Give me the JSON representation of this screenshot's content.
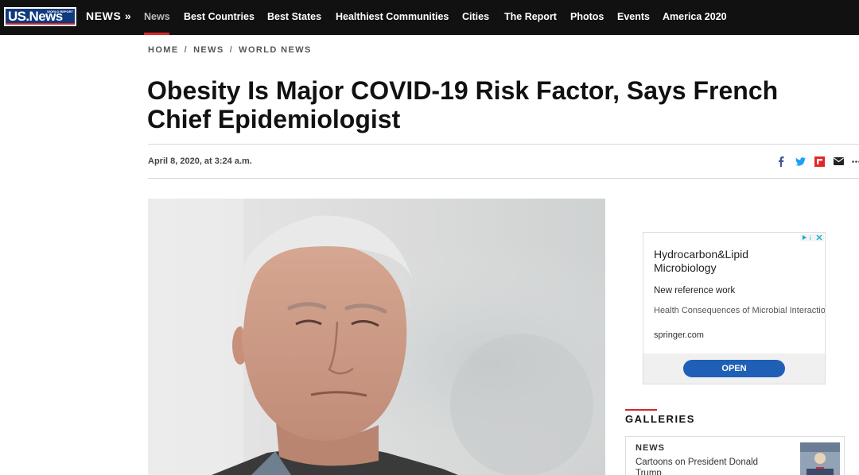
{
  "brand": {
    "logo_text": "US.News",
    "logo_small": "WORLD REPORT",
    "red": "#d6242b",
    "blue": "#0f3a7d"
  },
  "nav": {
    "home_label": "NEWS »",
    "items": [
      "News",
      "Best Countries",
      "Best States",
      "Healthiest Communities",
      "Cities",
      "The Report",
      "Photos",
      "Events",
      "America 2020"
    ]
  },
  "breadcrumb": [
    "HOME",
    "NEWS",
    "WORLD NEWS"
  ],
  "article": {
    "title": "Obesity Is Major COVID-19 Risk Factor, Says French Chief Epidemiologist",
    "date": "April 8, 2020, at 3:24 a.m."
  },
  "share_icons": [
    "facebook-icon",
    "twitter-icon",
    "flipboard-icon",
    "email-icon",
    "more-icon"
  ],
  "ad": {
    "title": "Hydrocarbon&Lipid Microbiology",
    "subtitle": "New reference work",
    "description": "Health Consequences of Microbial Interactions with Hydrocarbons, Oils, and Lipids",
    "domain": "springer.com",
    "button": "OPEN"
  },
  "galleries": {
    "heading": "GALLERIES",
    "card_kicker": "NEWS",
    "card_text": "Cartoons on President Donald Trump"
  }
}
